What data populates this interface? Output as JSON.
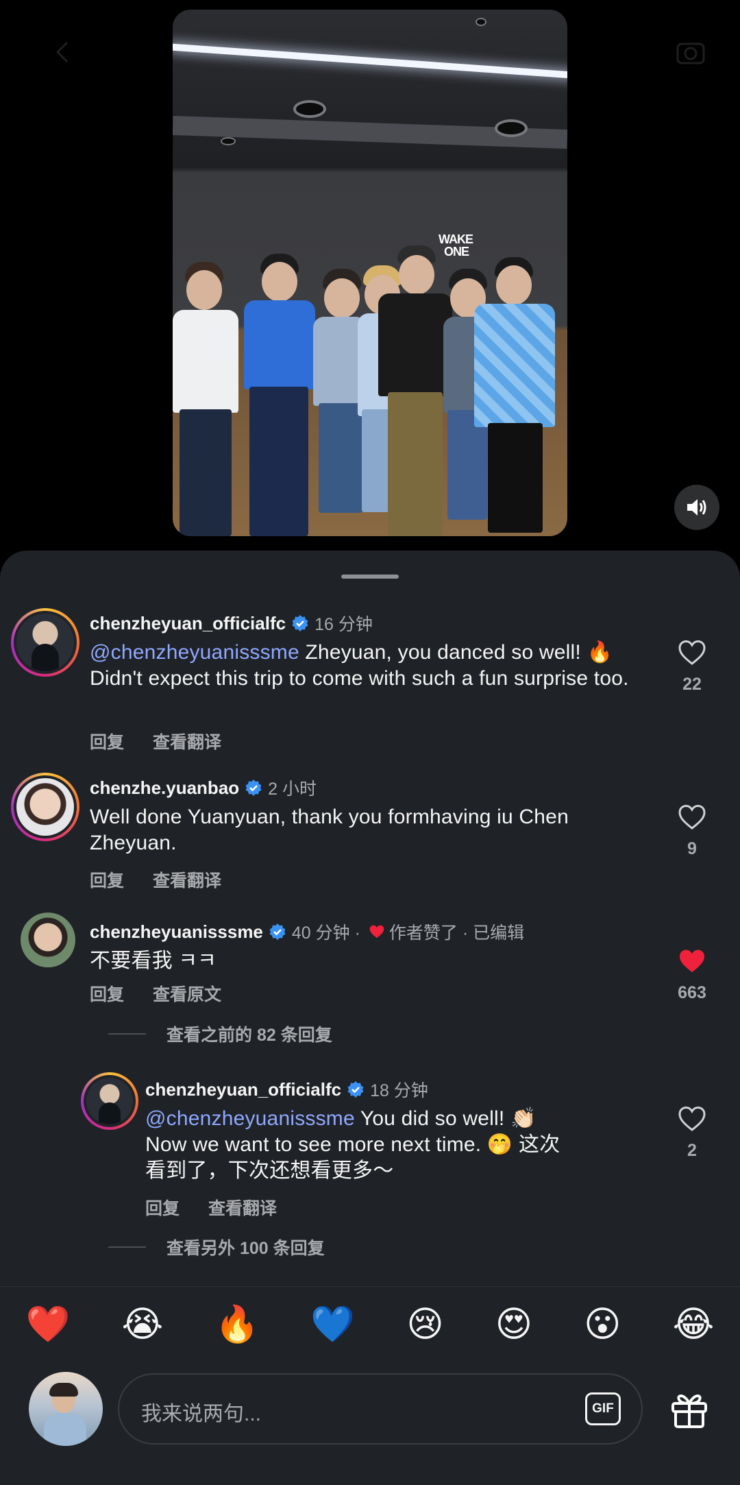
{
  "video": {
    "wall_logo_line1": "WAKE",
    "wall_logo_line2": "ONE",
    "sound_icon": "speaker-icon"
  },
  "comments": [
    {
      "username": "chenzheyuan_officialfc",
      "verified": true,
      "time": "16 分钟",
      "mention": "@chenzheyuanisssme",
      "text": " Zheyuan, you danced so well! 🔥 Didn't expect this trip to come with such a fun surprise too.",
      "reply_label": "回复",
      "translate_label": "查看翻译",
      "likes": "22",
      "liked": false
    },
    {
      "username": "chenzhe.yuanbao",
      "verified": true,
      "time": "2 小时",
      "text": "Well done Yuanyuan, thank you formhaving iu Chen Zheyuan.",
      "reply_label": "回复",
      "translate_label": "查看翻译",
      "likes": "9",
      "liked": false
    },
    {
      "username": "chenzheyuanisssme",
      "verified": true,
      "time": "40 分钟 ·",
      "author_liked": "作者赞了 · 已编辑",
      "text": "不要看我 ㅋㅋ",
      "reply_label": "回复",
      "original_label": "查看原文",
      "likes": "663",
      "liked": true,
      "view_previous": "查看之前的 82 条回复"
    }
  ],
  "reply": {
    "username": "chenzheyuan_officialfc",
    "verified": true,
    "time": "18 分钟",
    "mention": "@chenzheyuanisssme",
    "text_line1": " You did so well! 👏🏻",
    "text_line2": "Now we want to see more next time. 🤭 这次",
    "text_line3": "看到了，下次还想看更多～",
    "reply_label": "回复",
    "translate_label": "查看翻译",
    "likes": "2",
    "liked": false,
    "view_more": "查看另外 100 条回复"
  },
  "emoji_bar": [
    "❤️",
    "😭",
    "🔥",
    "💙",
    "😢",
    "😍",
    "😮",
    "😂"
  ],
  "composer": {
    "placeholder": "我来说两句...",
    "gif_label": "GIF"
  },
  "colors": {
    "sheet_bg": "#1f2226",
    "mention": "#8fa8ff",
    "like_red": "#f0213c",
    "verified_blue": "#3a92f5"
  }
}
